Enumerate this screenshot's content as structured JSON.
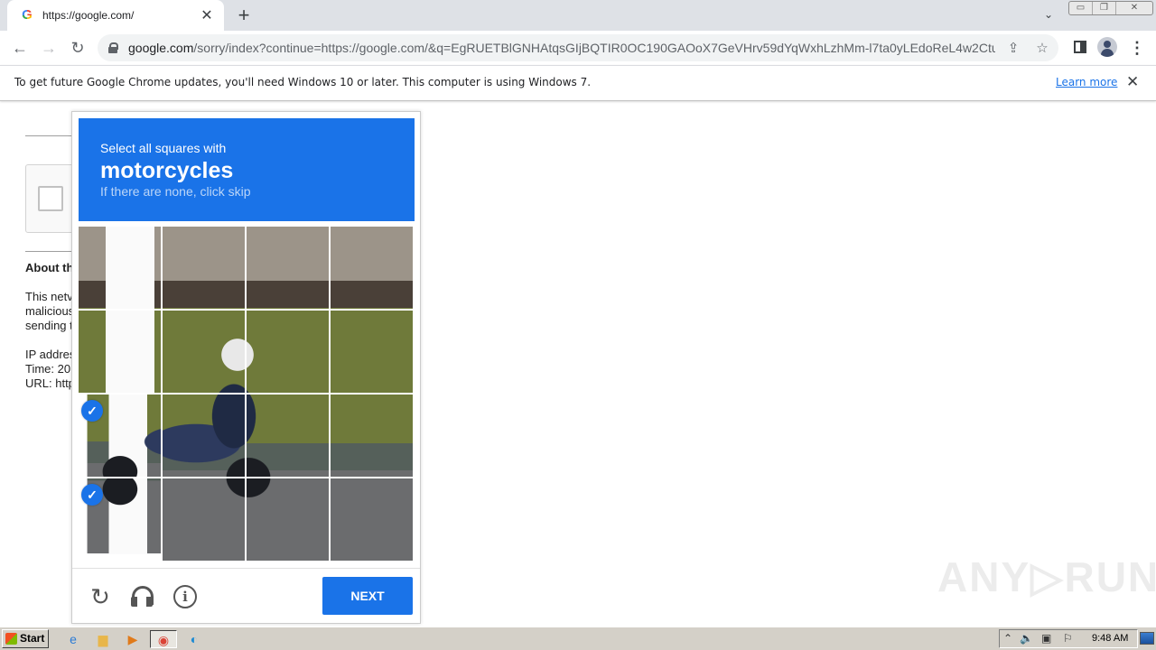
{
  "browser": {
    "tab": {
      "title": "https://google.com/",
      "favicon": "google-g-icon"
    },
    "url": {
      "host": "google.com",
      "path": "/sorry/index?continue=https://google.com/&q=EgRUETBlGNHAtqsGIjBQTIR0OC190GAOoX7GeVHrv59dYqWxhLzhMm-l7ta0yLEdoReL4w2Ctu..."
    },
    "icons": {
      "back": "←",
      "forward": "→",
      "reload": "↻",
      "share": "⇪",
      "star": "☆",
      "menu": "⋮",
      "new_tab": "+",
      "tab_close": "✕",
      "tab_search": "⌄"
    },
    "window_controls": {
      "minimize": "▭",
      "restore": "❐",
      "close": "✕"
    }
  },
  "infobar": {
    "message": "To get future Google Chrome updates, you'll need Windows 10 or later. This computer is using Windows 7.",
    "link": "Learn more",
    "close": "✕"
  },
  "page": {
    "about_heading": "About th",
    "paragraph_lines": [
      "This netv",
      "malicious",
      "sending t"
    ],
    "info_lines": [
      "IP addres",
      "Time: 20",
      "URL: http"
    ]
  },
  "captcha": {
    "instruction": "Select all squares with",
    "target": "motorcycles",
    "hint": "If there are none, click skip",
    "grid_rows": 4,
    "grid_cols": 4,
    "selected_tiles": [
      8,
      12
    ],
    "check_glyph": "✓",
    "footer": {
      "reload": "reload-icon",
      "audio": "headphones-icon",
      "info": "info-icon",
      "info_glyph": "i",
      "reload_glyph": "↻",
      "next_label": "NEXT"
    },
    "colors": {
      "accent": "#1a73e8"
    }
  },
  "watermark": "ANY▷RUN",
  "taskbar": {
    "start_label": "Start",
    "apps": [
      {
        "name": "internet-explorer",
        "glyph": "e",
        "color": "#2b7bd6"
      },
      {
        "name": "file-explorer",
        "glyph": "▆",
        "color": "#e8b64a"
      },
      {
        "name": "media-player",
        "glyph": "▶",
        "color": "#e07a1a"
      },
      {
        "name": "chrome",
        "glyph": "◉",
        "color": "#db4437",
        "active": true
      },
      {
        "name": "edge",
        "glyph": "◐",
        "color": "#1c8ad3"
      }
    ],
    "tray": {
      "chevron": "⌃",
      "volume": "🔈",
      "network": "▣",
      "flag": "⚐"
    },
    "clock": "9:48 AM"
  }
}
